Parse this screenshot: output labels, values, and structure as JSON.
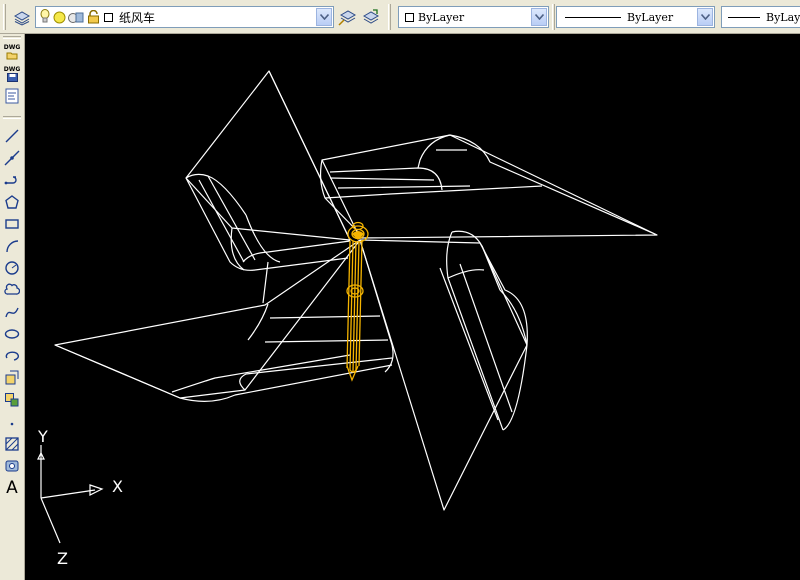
{
  "toolbar": {
    "layer_name": "纸风车",
    "color_control": "ByLayer",
    "linetype_control": "ByLayer",
    "lineweight_control": "ByLaye"
  },
  "left_toolbar": {
    "dwg_label_1": "DWG",
    "dwg_label_2": "DWG",
    "text_tool": "A"
  },
  "ucs": {
    "x_label": "X",
    "y_label": "Y",
    "z_label": "Z"
  },
  "colors": {
    "background": "#000000",
    "wireframe": "#ffffff",
    "selected_pin": "#f5b400",
    "toolbar_bg": "#ece9d8"
  }
}
